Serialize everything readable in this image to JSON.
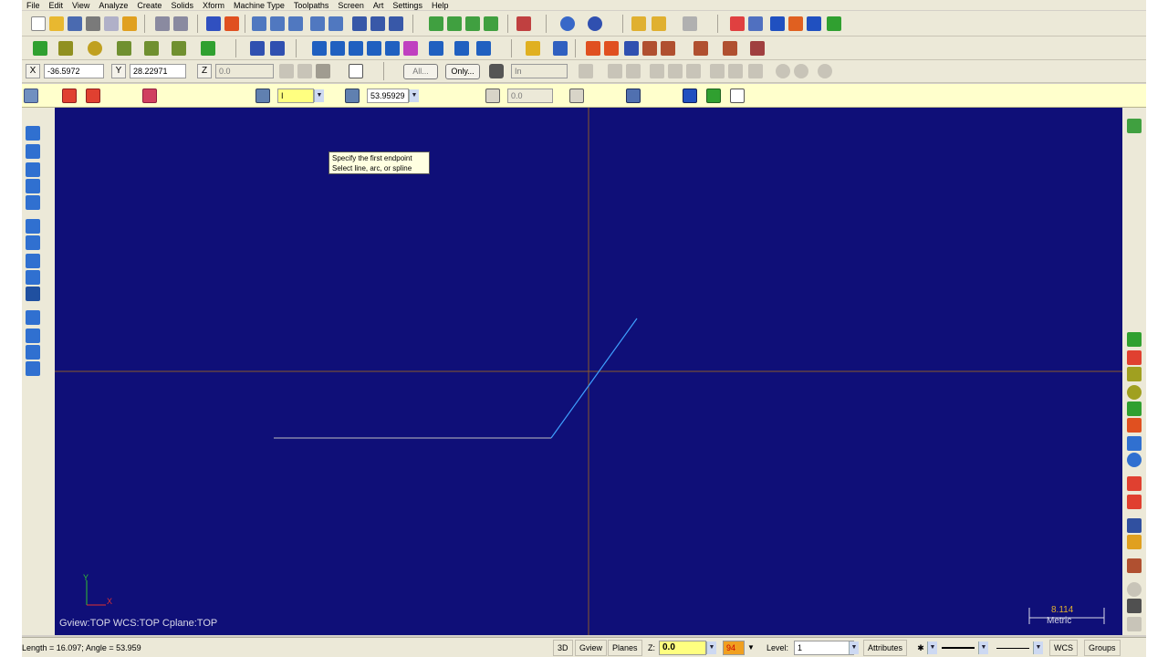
{
  "menu": [
    "File",
    "Edit",
    "View",
    "Analyze",
    "Create",
    "Solids",
    "Xform",
    "Machine Type",
    "Toolpaths",
    "Screen",
    "Art",
    "Settings",
    "Help"
  ],
  "coords": {
    "x_label": "X",
    "x_value": "-36.5972",
    "y_label": "Y",
    "y_value": "28.22971",
    "z_label": "Z",
    "z_value": "0.0",
    "all_label": "All...",
    "only_label": "Only...",
    "units_value": "In"
  },
  "ribbon": {
    "length_value": "I",
    "angle_value": "53.95929",
    "vertical_value": "0.0"
  },
  "tooltip": {
    "line1": "Specify the first endpoint",
    "line2": "Select line, arc, or spline"
  },
  "viewport": {
    "status_text": "Gview:TOP   WCS:TOP   Cplane:TOP",
    "axis_x": "X",
    "axis_y": "Y",
    "scale_value": "8.114",
    "scale_unit": "Metric",
    "background_color": "#0f0f78",
    "crosshair_color": "#8a5a2a",
    "geometry_color": "#3fa0ff",
    "horizontal_line_color": "#bfbfbf"
  },
  "status": {
    "message": "Length = 16.097; Angle = 53.959",
    "btn_3d": "3D",
    "btn_gview": "Gview",
    "btn_planes": "Planes",
    "z_label": "Z:",
    "z_value": "0.0",
    "color_value": "94",
    "level_label": "Level:",
    "level_value": "1",
    "btn_attributes": "Attributes",
    "btn_wcs": "WCS",
    "btn_groups": "Groups"
  }
}
